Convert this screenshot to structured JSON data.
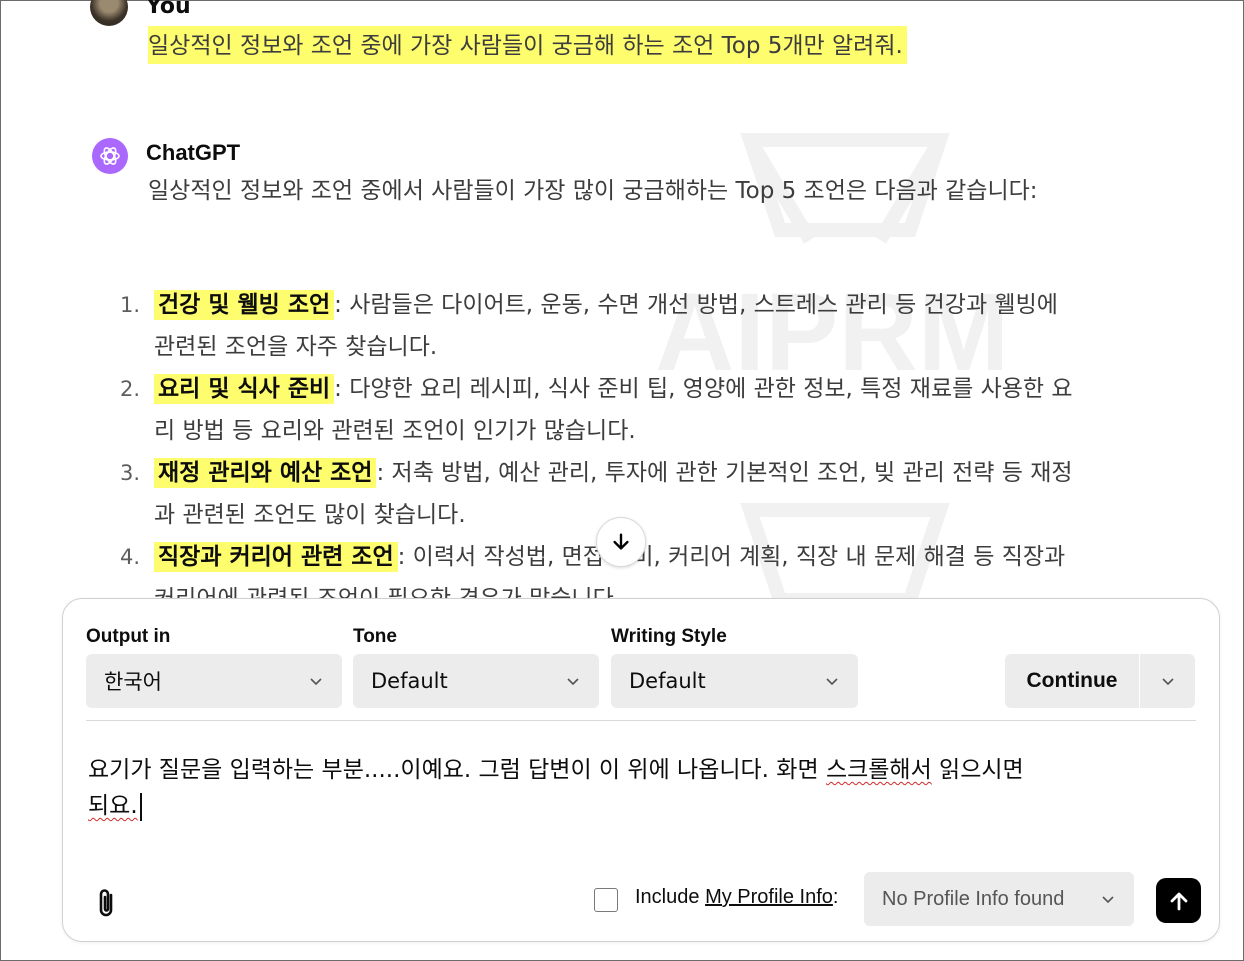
{
  "user": {
    "name": "You",
    "message": "일상적인 정보와 조언 중에 가장 사람들이 궁금해 하는 조언 Top 5개만 알려줘."
  },
  "assistant": {
    "name": "ChatGPT",
    "intro": "일상적인 정보와 조언 중에서 사람들이 가장 많이 궁금해하는 Top 5 조언은 다음과 같습니다:",
    "items": [
      {
        "num": "1.",
        "title": "건강 및 웰빙 조언",
        "text": ": 사람들은 다이어트, 운동, 수면 개선 방법, 스트레스 관리 등 건강과 웰빙에 관련된 조언을 자주 찾습니다."
      },
      {
        "num": "2.",
        "title": "요리 및 식사 준비",
        "text": ": 다양한 요리 레시피, 식사 준비 팁, 영양에 관한 정보, 특정 재료를 사용한 요리 방법 등 요리와 관련된 조언이 인기가 많습니다."
      },
      {
        "num": "3.",
        "title": "재정 관리와 예산 조언",
        "text": ": 저축 방법, 예산 관리, 투자에 관한 기본적인 조언, 빚 관리 전략 등 재정과 관련된 조언도 많이 찾습니다."
      },
      {
        "num": "4.",
        "title": "직장과 커리어 관련 조언",
        "text": ": 이력서 작성법, 면접 준비, 커리어 계획, 직장 내 문제 해결 등 직장과 커리어에 관련된 조언이 필요한 경우가 많습니다."
      }
    ]
  },
  "watermark": "AIPRM",
  "composer": {
    "output_label": "Output in",
    "output_value": "한국어",
    "tone_label": "Tone",
    "tone_value": "Default",
    "style_label": "Writing Style",
    "style_value": "Default",
    "continue_label": "Continue",
    "prompt_part1": "요기가 질문을 입력하는 부분.....이예요. 그럼  답변이 이 위에 나옵니다. 화면 ",
    "prompt_squig1": "스크롤해서",
    "prompt_part2": " 읽으시면 ",
    "prompt_squig2": "되요.",
    "include_prefix": "Include ",
    "include_link": "My Profile Info",
    "include_suffix": ":",
    "profile_value": "No Profile Info found"
  },
  "icons": [
    "chatgpt-logo-icon",
    "arrow-down-icon",
    "chevron-down-icon",
    "paperclip-icon",
    "arrow-up-icon"
  ]
}
